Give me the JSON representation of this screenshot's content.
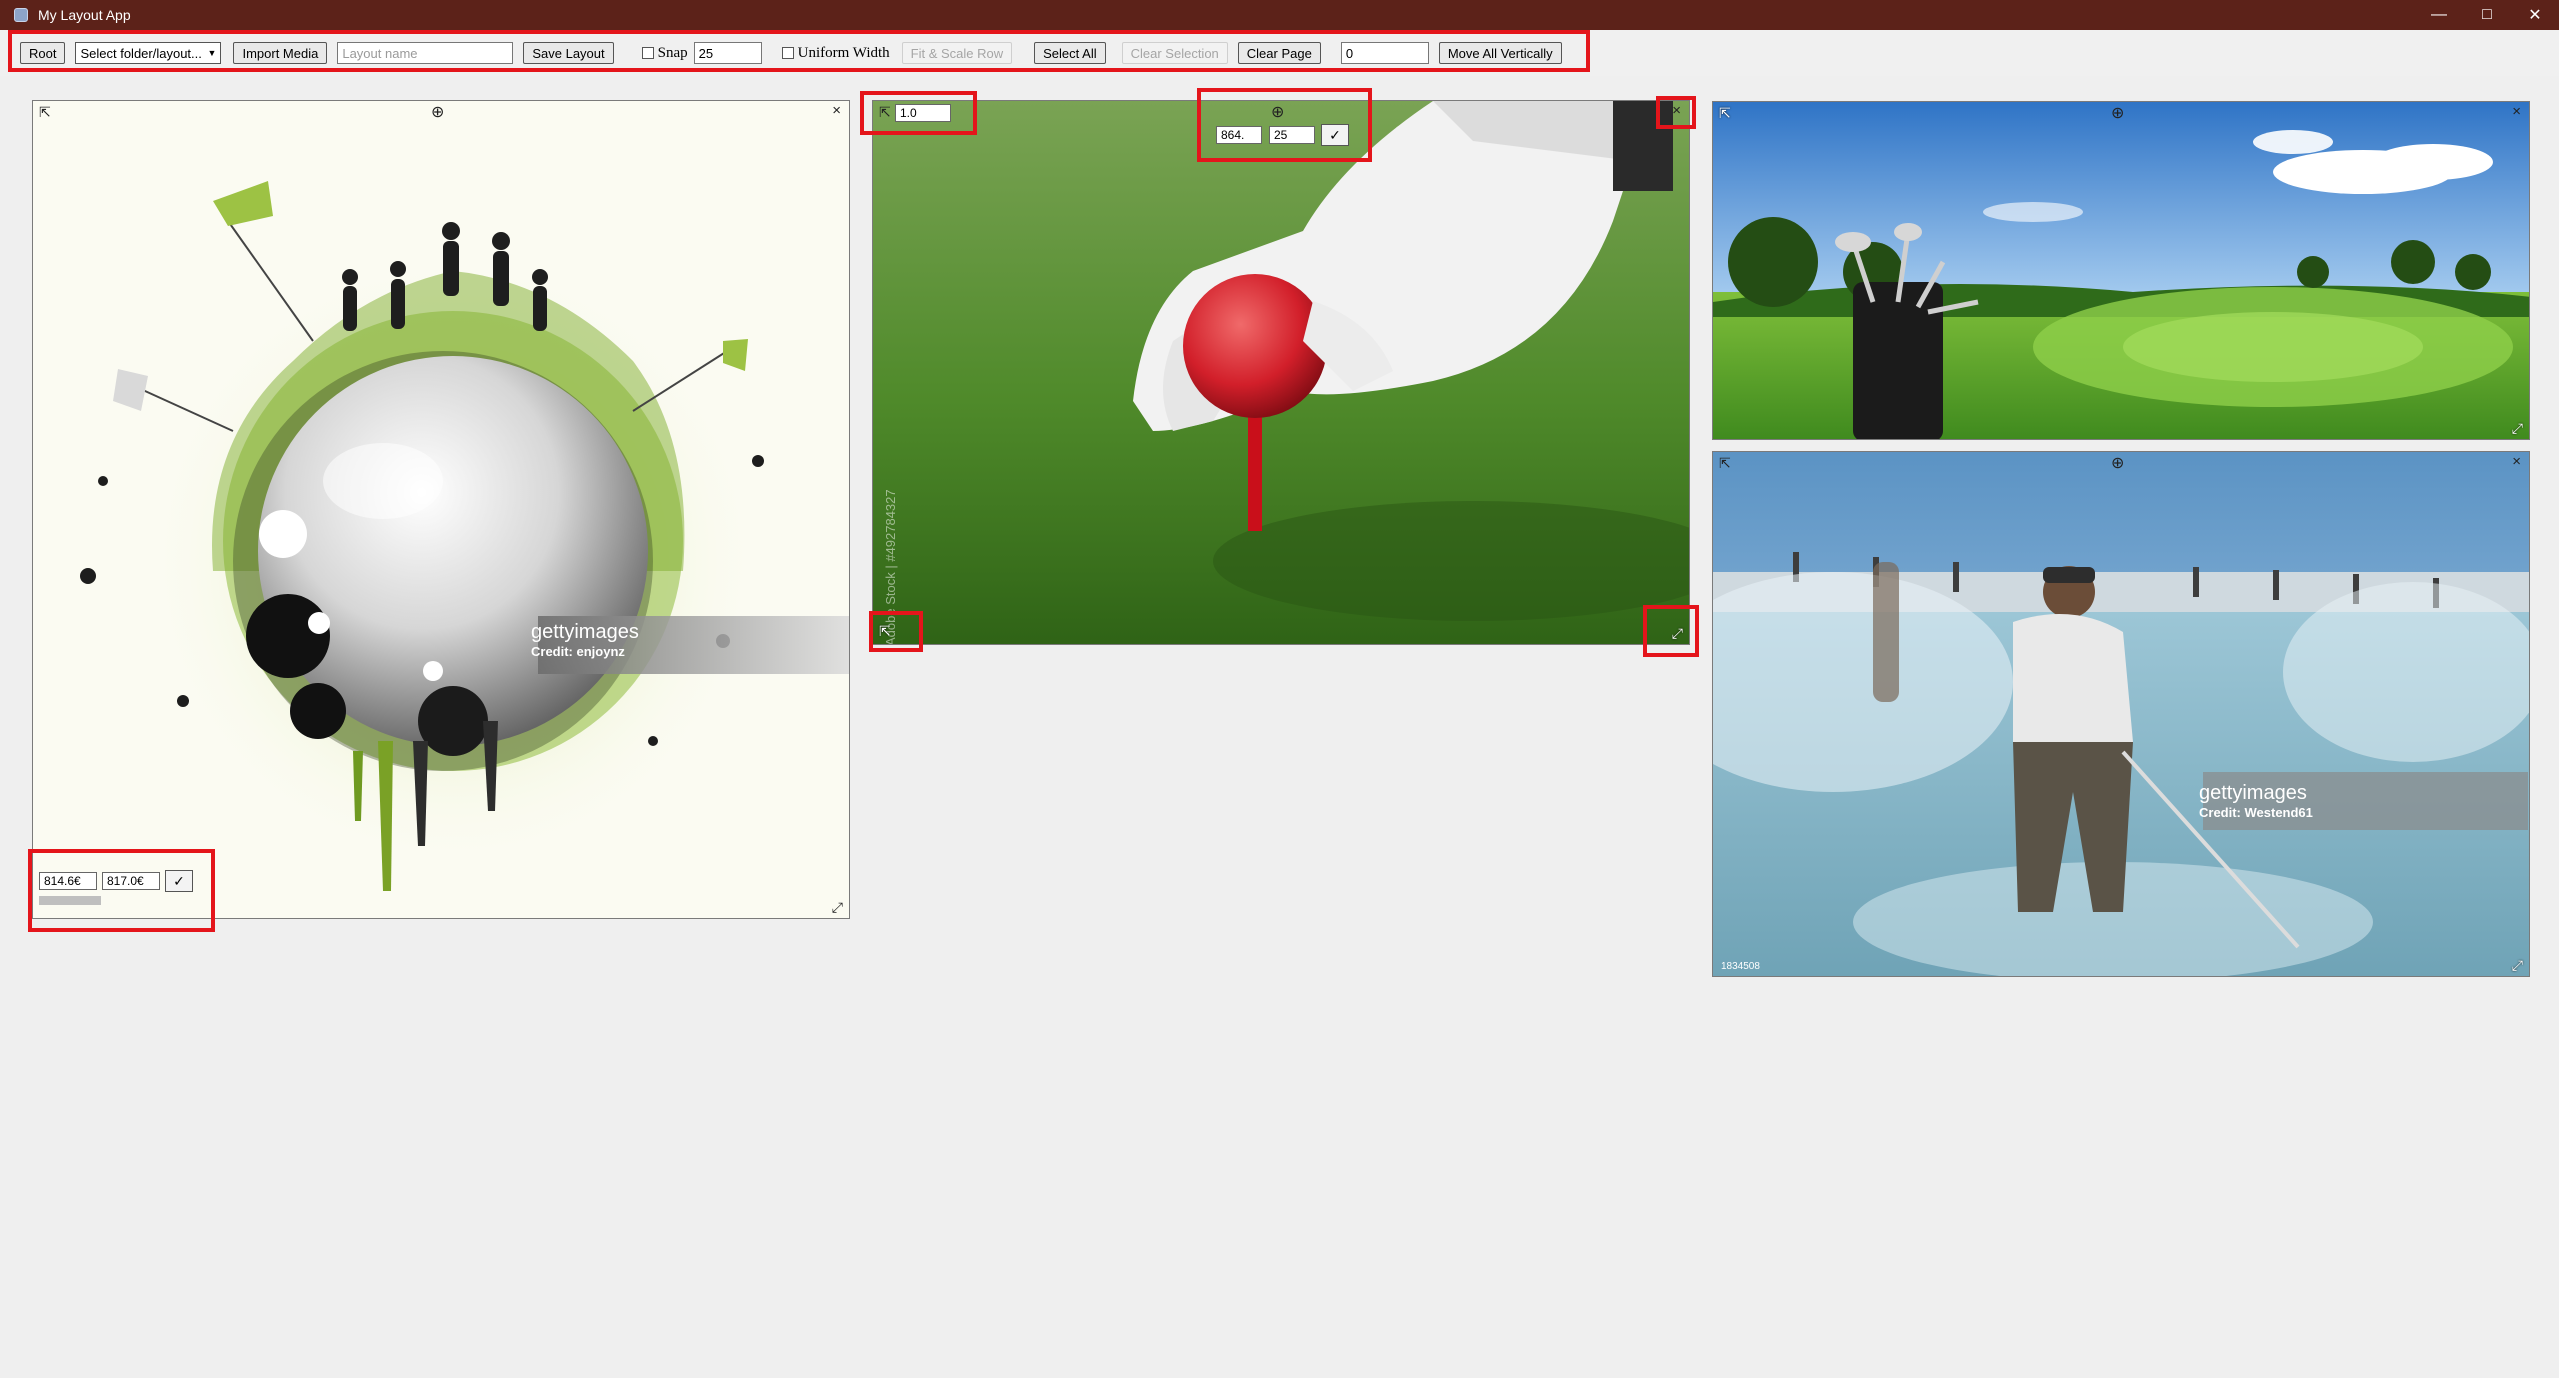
{
  "window": {
    "title": "My Layout App",
    "minimize_glyph": "—",
    "maximize_glyph": "□",
    "close_glyph": "✕"
  },
  "toolbar": {
    "root_label": "Root",
    "folder_select_value": "Select folder/layout...",
    "import_label": "Import Media",
    "layout_name_placeholder": "Layout name",
    "save_label": "Save Layout",
    "snap_label": "Snap",
    "snap_value": "25",
    "uniform_width_label": "Uniform Width",
    "fit_scale_label": "Fit & Scale Row",
    "select_all_label": "Select All",
    "clear_selection_label": "Clear Selection",
    "clear_page_label": "Clear Page",
    "vertical_offset_value": "0",
    "move_vertically_label": "Move All Vertically"
  },
  "cards": {
    "golf_ball": {
      "width_value": "814.6€",
      "height_value": "817.0€",
      "ok_label": "✓",
      "getty_brand": "gettyimages",
      "getty_credit": "Credit: enjoynz"
    },
    "tee": {
      "scale_value": "1.0",
      "width_value": "864.",
      "snap_value": "25",
      "ok_label": "✓",
      "watermark": "Adobe Stock | #492784327"
    },
    "fountain": {
      "getty_brand": "gettyimages",
      "getty_credit": "Credit: Westend61",
      "stamp": "1834508"
    }
  },
  "icons": {
    "move": "⊕",
    "corner_top_left": "⇱",
    "close": "×",
    "resize": "⤢",
    "check": "✓",
    "dropdown": "▼"
  },
  "colors": {
    "titlebar": "#5c2219",
    "annotation": "#e4151b",
    "canvas": "#efefef"
  }
}
